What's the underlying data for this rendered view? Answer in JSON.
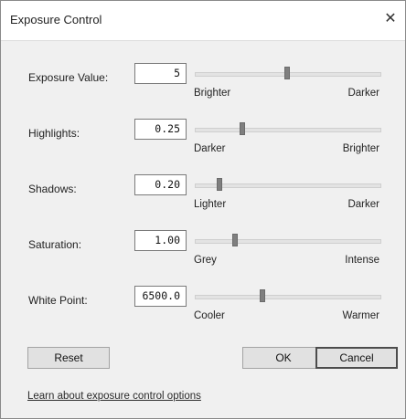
{
  "dialog": {
    "title": "Exposure Control"
  },
  "controls": [
    {
      "label": "Exposure Value:",
      "value": "5",
      "min_caption": "Brighter",
      "max_caption": "Darker",
      "slider_pos": 0.5
    },
    {
      "label": "Highlights:",
      "value": "0.25",
      "min_caption": "Darker",
      "max_caption": "Brighter",
      "slider_pos": 0.25
    },
    {
      "label": "Shadows:",
      "value": "0.20",
      "min_caption": "Lighter",
      "max_caption": "Darker",
      "slider_pos": 0.12
    },
    {
      "label": "Saturation:",
      "value": "1.00",
      "min_caption": "Grey",
      "max_caption": "Intense",
      "slider_pos": 0.21
    },
    {
      "label": "White Point:",
      "value": "6500.0",
      "min_caption": "Cooler",
      "max_caption": "Warmer",
      "slider_pos": 0.36
    }
  ],
  "buttons": {
    "reset": "Reset",
    "ok": "OK",
    "cancel": "Cancel"
  },
  "link": "Learn about exposure control options"
}
